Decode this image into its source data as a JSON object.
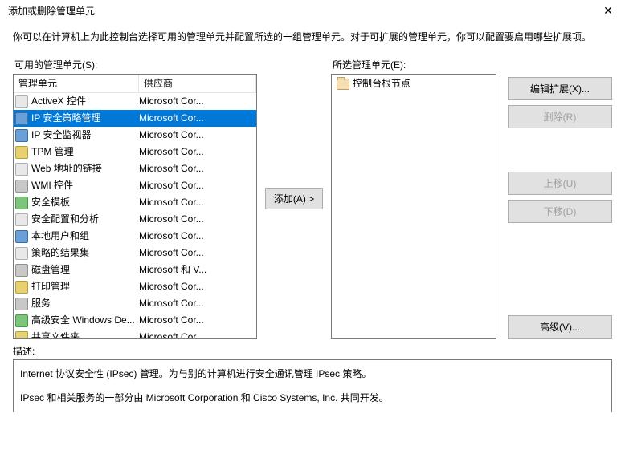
{
  "window": {
    "title": "添加或删除管理单元",
    "close_glyph": "✕"
  },
  "intro": "你可以在计算机上为此控制台选择可用的管理单元并配置所选的一组管理单元。对于可扩展的管理单元，你可以配置要启用哪些扩展项。",
  "available": {
    "label": "可用的管理单元(S):",
    "columns": {
      "name": "管理单元",
      "vendor": "供应商"
    },
    "rows": [
      {
        "name": "ActiveX 控件",
        "vendor": "Microsoft Cor...",
        "icon": "generic"
      },
      {
        "name": "IP 安全策略管理",
        "vendor": "Microsoft Cor...",
        "icon": "blue",
        "selected": true
      },
      {
        "name": "IP 安全监视器",
        "vendor": "Microsoft Cor...",
        "icon": "blue"
      },
      {
        "name": "TPM 管理",
        "vendor": "Microsoft Cor...",
        "icon": "yellow"
      },
      {
        "name": "Web 地址的链接",
        "vendor": "Microsoft Cor...",
        "icon": "generic"
      },
      {
        "name": "WMI 控件",
        "vendor": "Microsoft Cor...",
        "icon": "gray"
      },
      {
        "name": "安全模板",
        "vendor": "Microsoft Cor...",
        "icon": "green"
      },
      {
        "name": "安全配置和分析",
        "vendor": "Microsoft Cor...",
        "icon": "generic"
      },
      {
        "name": "本地用户和组",
        "vendor": "Microsoft Cor...",
        "icon": "blue"
      },
      {
        "name": "策略的结果集",
        "vendor": "Microsoft Cor...",
        "icon": "generic"
      },
      {
        "name": "磁盘管理",
        "vendor": "Microsoft 和 V...",
        "icon": "gray"
      },
      {
        "name": "打印管理",
        "vendor": "Microsoft Cor...",
        "icon": "yellow"
      },
      {
        "name": "服务",
        "vendor": "Microsoft Cor...",
        "icon": "gray"
      },
      {
        "name": "高级安全 Windows De...",
        "vendor": "Microsoft Cor...",
        "icon": "green"
      },
      {
        "name": "共享文件夹",
        "vendor": "Microsoft Cor...",
        "icon": "yellow"
      }
    ]
  },
  "selected": {
    "label": "所选管理单元(E):",
    "root": "控制台根节点"
  },
  "buttons": {
    "add": "添加(A) >",
    "edit_ext": "编辑扩展(X)...",
    "remove": "删除(R)",
    "move_up": "上移(U)",
    "move_down": "下移(D)",
    "advanced": "高级(V)..."
  },
  "description": {
    "label": "描述:",
    "line1": "Internet 协议安全性 (IPsec) 管理。为与别的计算机进行安全通讯管理 IPsec 策略。",
    "line2": "IPsec 和相关服务的一部分由 Microsoft Corporation 和 Cisco Systems, Inc. 共同开发。"
  }
}
